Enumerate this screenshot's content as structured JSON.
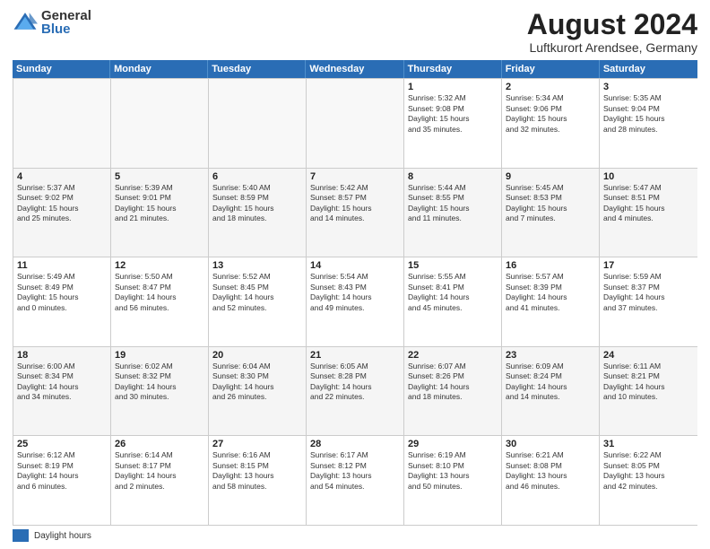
{
  "logo": {
    "general": "General",
    "blue": "Blue"
  },
  "title": {
    "month": "August 2024",
    "location": "Luftkurort Arendsee, Germany"
  },
  "days_of_week": [
    "Sunday",
    "Monday",
    "Tuesday",
    "Wednesday",
    "Thursday",
    "Friday",
    "Saturday"
  ],
  "rows": [
    [
      {
        "day": "",
        "info": "",
        "empty": true
      },
      {
        "day": "",
        "info": "",
        "empty": true
      },
      {
        "day": "",
        "info": "",
        "empty": true
      },
      {
        "day": "",
        "info": "",
        "empty": true
      },
      {
        "day": "1",
        "info": "Sunrise: 5:32 AM\nSunset: 9:08 PM\nDaylight: 15 hours\nand 35 minutes.",
        "empty": false
      },
      {
        "day": "2",
        "info": "Sunrise: 5:34 AM\nSunset: 9:06 PM\nDaylight: 15 hours\nand 32 minutes.",
        "empty": false
      },
      {
        "day": "3",
        "info": "Sunrise: 5:35 AM\nSunset: 9:04 PM\nDaylight: 15 hours\nand 28 minutes.",
        "empty": false
      }
    ],
    [
      {
        "day": "4",
        "info": "Sunrise: 5:37 AM\nSunset: 9:02 PM\nDaylight: 15 hours\nand 25 minutes.",
        "empty": false
      },
      {
        "day": "5",
        "info": "Sunrise: 5:39 AM\nSunset: 9:01 PM\nDaylight: 15 hours\nand 21 minutes.",
        "empty": false
      },
      {
        "day": "6",
        "info": "Sunrise: 5:40 AM\nSunset: 8:59 PM\nDaylight: 15 hours\nand 18 minutes.",
        "empty": false
      },
      {
        "day": "7",
        "info": "Sunrise: 5:42 AM\nSunset: 8:57 PM\nDaylight: 15 hours\nand 14 minutes.",
        "empty": false
      },
      {
        "day": "8",
        "info": "Sunrise: 5:44 AM\nSunset: 8:55 PM\nDaylight: 15 hours\nand 11 minutes.",
        "empty": false
      },
      {
        "day": "9",
        "info": "Sunrise: 5:45 AM\nSunset: 8:53 PM\nDaylight: 15 hours\nand 7 minutes.",
        "empty": false
      },
      {
        "day": "10",
        "info": "Sunrise: 5:47 AM\nSunset: 8:51 PM\nDaylight: 15 hours\nand 4 minutes.",
        "empty": false
      }
    ],
    [
      {
        "day": "11",
        "info": "Sunrise: 5:49 AM\nSunset: 8:49 PM\nDaylight: 15 hours\nand 0 minutes.",
        "empty": false
      },
      {
        "day": "12",
        "info": "Sunrise: 5:50 AM\nSunset: 8:47 PM\nDaylight: 14 hours\nand 56 minutes.",
        "empty": false
      },
      {
        "day": "13",
        "info": "Sunrise: 5:52 AM\nSunset: 8:45 PM\nDaylight: 14 hours\nand 52 minutes.",
        "empty": false
      },
      {
        "day": "14",
        "info": "Sunrise: 5:54 AM\nSunset: 8:43 PM\nDaylight: 14 hours\nand 49 minutes.",
        "empty": false
      },
      {
        "day": "15",
        "info": "Sunrise: 5:55 AM\nSunset: 8:41 PM\nDaylight: 14 hours\nand 45 minutes.",
        "empty": false
      },
      {
        "day": "16",
        "info": "Sunrise: 5:57 AM\nSunset: 8:39 PM\nDaylight: 14 hours\nand 41 minutes.",
        "empty": false
      },
      {
        "day": "17",
        "info": "Sunrise: 5:59 AM\nSunset: 8:37 PM\nDaylight: 14 hours\nand 37 minutes.",
        "empty": false
      }
    ],
    [
      {
        "day": "18",
        "info": "Sunrise: 6:00 AM\nSunset: 8:34 PM\nDaylight: 14 hours\nand 34 minutes.",
        "empty": false
      },
      {
        "day": "19",
        "info": "Sunrise: 6:02 AM\nSunset: 8:32 PM\nDaylight: 14 hours\nand 30 minutes.",
        "empty": false
      },
      {
        "day": "20",
        "info": "Sunrise: 6:04 AM\nSunset: 8:30 PM\nDaylight: 14 hours\nand 26 minutes.",
        "empty": false
      },
      {
        "day": "21",
        "info": "Sunrise: 6:05 AM\nSunset: 8:28 PM\nDaylight: 14 hours\nand 22 minutes.",
        "empty": false
      },
      {
        "day": "22",
        "info": "Sunrise: 6:07 AM\nSunset: 8:26 PM\nDaylight: 14 hours\nand 18 minutes.",
        "empty": false
      },
      {
        "day": "23",
        "info": "Sunrise: 6:09 AM\nSunset: 8:24 PM\nDaylight: 14 hours\nand 14 minutes.",
        "empty": false
      },
      {
        "day": "24",
        "info": "Sunrise: 6:11 AM\nSunset: 8:21 PM\nDaylight: 14 hours\nand 10 minutes.",
        "empty": false
      }
    ],
    [
      {
        "day": "25",
        "info": "Sunrise: 6:12 AM\nSunset: 8:19 PM\nDaylight: 14 hours\nand 6 minutes.",
        "empty": false
      },
      {
        "day": "26",
        "info": "Sunrise: 6:14 AM\nSunset: 8:17 PM\nDaylight: 14 hours\nand 2 minutes.",
        "empty": false
      },
      {
        "day": "27",
        "info": "Sunrise: 6:16 AM\nSunset: 8:15 PM\nDaylight: 13 hours\nand 58 minutes.",
        "empty": false
      },
      {
        "day": "28",
        "info": "Sunrise: 6:17 AM\nSunset: 8:12 PM\nDaylight: 13 hours\nand 54 minutes.",
        "empty": false
      },
      {
        "day": "29",
        "info": "Sunrise: 6:19 AM\nSunset: 8:10 PM\nDaylight: 13 hours\nand 50 minutes.",
        "empty": false
      },
      {
        "day": "30",
        "info": "Sunrise: 6:21 AM\nSunset: 8:08 PM\nDaylight: 13 hours\nand 46 minutes.",
        "empty": false
      },
      {
        "day": "31",
        "info": "Sunrise: 6:22 AM\nSunset: 8:05 PM\nDaylight: 13 hours\nand 42 minutes.",
        "empty": false
      }
    ]
  ],
  "footer": {
    "daylight_label": "Daylight hours"
  }
}
